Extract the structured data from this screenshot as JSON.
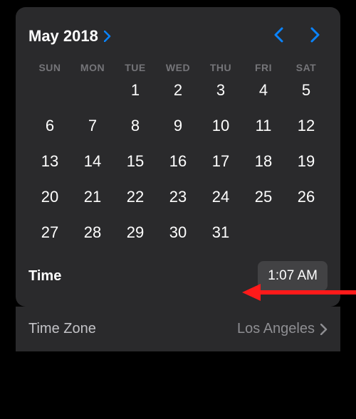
{
  "header": {
    "month_year": "May 2018"
  },
  "weekdays": [
    "SUN",
    "MON",
    "TUE",
    "WED",
    "THU",
    "FRI",
    "SAT"
  ],
  "days": [
    "",
    "",
    "1",
    "2",
    "3",
    "4",
    "5",
    "6",
    "7",
    "8",
    "9",
    "10",
    "11",
    "12",
    "13",
    "14",
    "15",
    "16",
    "17",
    "18",
    "19",
    "20",
    "21",
    "22",
    "23",
    "24",
    "25",
    "26",
    "27",
    "28",
    "29",
    "30",
    "31",
    "",
    ""
  ],
  "time": {
    "label": "Time",
    "value": "1:07 AM"
  },
  "timezone": {
    "label": "Time Zone",
    "value": "Los Angeles"
  }
}
